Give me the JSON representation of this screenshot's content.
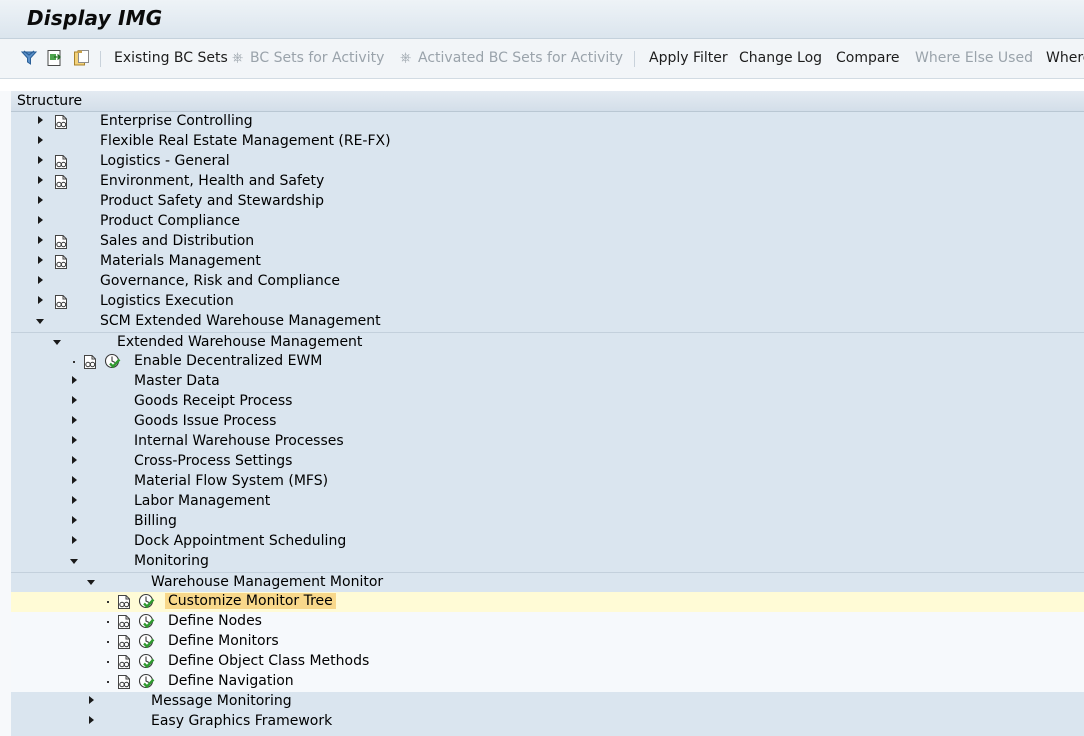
{
  "window": {
    "title": "Display IMG"
  },
  "toolbar": {
    "existing_bc_sets": "Existing BC Sets",
    "bc_sets_for_activity": "BC Sets for Activity",
    "activated_bc_sets": "Activated BC Sets for Activity",
    "apply_filter": "Apply Filter",
    "change_log": "Change Log",
    "compare": "Compare",
    "where_else_used": "Where Else Used",
    "where_cut": "Where"
  },
  "tree": {
    "header": "Structure",
    "colors": {
      "band_blue": "#dae5ef",
      "band_light": "#f6f9fc",
      "selected": "#fffbd6",
      "selected_label": "#f8d88b"
    },
    "nodes": [
      {
        "label": "Enterprise Controlling",
        "level": 0,
        "state": "collapsed",
        "doc": true,
        "clock": false
      },
      {
        "label": "Flexible Real Estate Management (RE-FX)",
        "level": 0,
        "state": "collapsed",
        "doc": false,
        "clock": false
      },
      {
        "label": "Logistics - General",
        "level": 0,
        "state": "collapsed",
        "doc": true,
        "clock": false
      },
      {
        "label": "Environment, Health and Safety",
        "level": 0,
        "state": "collapsed",
        "doc": true,
        "clock": false
      },
      {
        "label": "Product Safety and Stewardship",
        "level": 0,
        "state": "collapsed",
        "doc": false,
        "clock": false
      },
      {
        "label": "Product Compliance",
        "level": 0,
        "state": "collapsed",
        "doc": false,
        "clock": false
      },
      {
        "label": "Sales and Distribution",
        "level": 0,
        "state": "collapsed",
        "doc": true,
        "clock": false
      },
      {
        "label": "Materials Management",
        "level": 0,
        "state": "collapsed",
        "doc": true,
        "clock": false
      },
      {
        "label": "Governance, Risk and Compliance",
        "level": 0,
        "state": "collapsed",
        "doc": false,
        "clock": false
      },
      {
        "label": "Logistics Execution",
        "level": 0,
        "state": "collapsed",
        "doc": true,
        "clock": false
      },
      {
        "label": "SCM Extended Warehouse Management",
        "level": 0,
        "state": "expanded",
        "doc": false,
        "clock": false
      },
      {
        "label": "Extended Warehouse Management",
        "level": 1,
        "state": "expanded",
        "doc": false,
        "clock": false
      },
      {
        "label": "Enable Decentralized EWM",
        "level": 2,
        "state": "leaf",
        "doc": true,
        "clock": true
      },
      {
        "label": "Master Data",
        "level": 2,
        "state": "collapsed",
        "doc": false,
        "clock": false
      },
      {
        "label": "Goods Receipt Process",
        "level": 2,
        "state": "collapsed",
        "doc": false,
        "clock": false
      },
      {
        "label": "Goods Issue Process",
        "level": 2,
        "state": "collapsed",
        "doc": false,
        "clock": false
      },
      {
        "label": "Internal Warehouse Processes",
        "level": 2,
        "state": "collapsed",
        "doc": false,
        "clock": false
      },
      {
        "label": "Cross-Process Settings",
        "level": 2,
        "state": "collapsed",
        "doc": false,
        "clock": false
      },
      {
        "label": "Material Flow System (MFS)",
        "level": 2,
        "state": "collapsed",
        "doc": false,
        "clock": false
      },
      {
        "label": "Labor Management",
        "level": 2,
        "state": "collapsed",
        "doc": false,
        "clock": false
      },
      {
        "label": "Billing",
        "level": 2,
        "state": "collapsed",
        "doc": false,
        "clock": false
      },
      {
        "label": "Dock Appointment Scheduling",
        "level": 2,
        "state": "collapsed",
        "doc": false,
        "clock": false
      },
      {
        "label": "Monitoring",
        "level": 2,
        "state": "expanded",
        "doc": false,
        "clock": false
      },
      {
        "label": "Warehouse Management Monitor",
        "level": 3,
        "state": "expanded",
        "doc": false,
        "clock": false
      },
      {
        "label": "Customize Monitor Tree",
        "level": 4,
        "state": "leaf",
        "doc": true,
        "clock": true,
        "selected": true
      },
      {
        "label": "Define Nodes",
        "level": 4,
        "state": "leaf",
        "doc": true,
        "clock": true
      },
      {
        "label": "Define Monitors",
        "level": 4,
        "state": "leaf",
        "doc": true,
        "clock": true
      },
      {
        "label": "Define Object Class Methods",
        "level": 4,
        "state": "leaf",
        "doc": true,
        "clock": true
      },
      {
        "label": "Define Navigation",
        "level": 4,
        "state": "leaf",
        "doc": true,
        "clock": true
      },
      {
        "label": "Message Monitoring",
        "level": 3,
        "state": "collapsed",
        "doc": false,
        "clock": false
      },
      {
        "label": "Easy Graphics Framework",
        "level": 3,
        "state": "collapsed",
        "doc": false,
        "clock": false
      }
    ]
  }
}
